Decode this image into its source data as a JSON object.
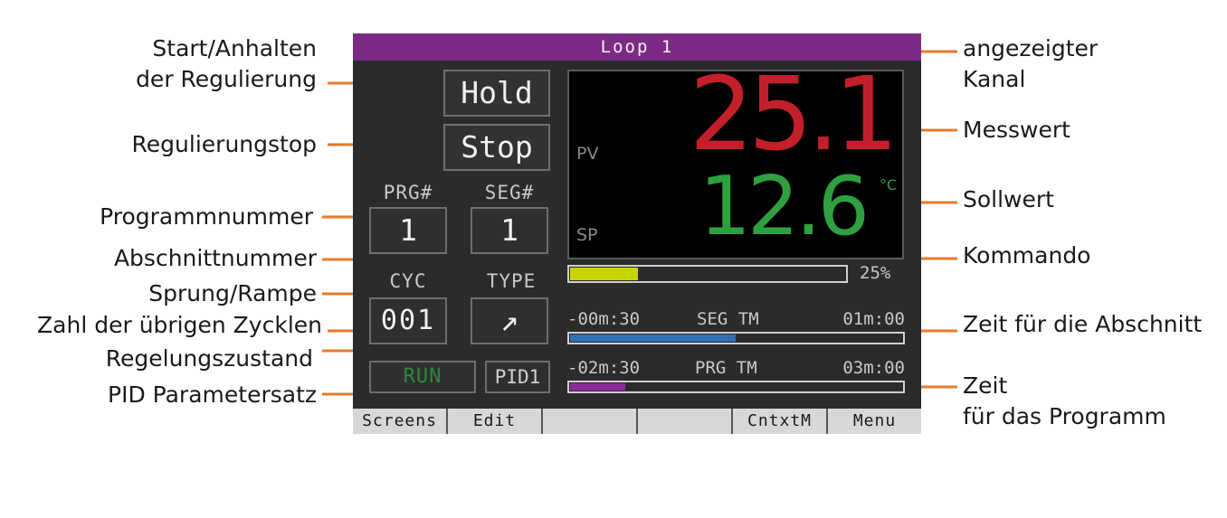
{
  "colors": {
    "leader": "#e87a2a",
    "title_bar": "#7d2a86",
    "pv": "#c4202c",
    "sp": "#2fa040",
    "command_bar": "#c8d400",
    "seg_bar": "#2f6fb5",
    "prg_bar": "#8a2b9a",
    "status": "#2b8a3a"
  },
  "labels_left": {
    "start_hold": "Start/Anhalten",
    "start_hold_2": "der Regulierung",
    "stop": "Regulierungstop",
    "program_number": "Programmnummer",
    "segment_number": "Abschnittnummer",
    "step_ramp": "Sprung/Rampe",
    "cycles_left": "Zahl der übrigen Zycklen",
    "control_state": "Regelungszustand",
    "pid_set": "PID Parametersatz"
  },
  "labels_right": {
    "channel": "angezeigter",
    "channel_2": "Kanal",
    "measured": "Messwert",
    "setpoint": "Sollwert",
    "command": "Kommando",
    "segment_time": "Zeit für die Abschnitt",
    "program_time": "Zeit",
    "program_time_2": "für das Programm"
  },
  "screen": {
    "title": "Loop 1",
    "hold_button": "Hold",
    "stop_button": "Stop",
    "prg_caption": "PRG#",
    "prg_value": "1",
    "seg_caption": "SEG#",
    "seg_value": "1",
    "cyc_caption": "CYC",
    "cyc_value": "001",
    "type_caption": "TYPE",
    "type_icon": "ramp-up-arrow-icon",
    "type_glyph": "↗",
    "status": "RUN",
    "pid": "PID1",
    "pv_label": "PV",
    "pv_value": "25.1",
    "sp_label": "SP",
    "sp_value": "12.6",
    "unit": "°C",
    "command_percent": 0.25,
    "command_text": "25%",
    "seg_remaining": "-00m:30",
    "seg_label": "SEG TM",
    "seg_total": "01m:00",
    "seg_progress": 0.5,
    "prg_remaining": "-02m:30",
    "prg_label": "PRG TM",
    "prg_total": "03m:00",
    "prg_progress": 0.17
  },
  "footer": [
    "Screens",
    "Edit",
    "",
    "",
    "CntxtM",
    "Menu"
  ]
}
